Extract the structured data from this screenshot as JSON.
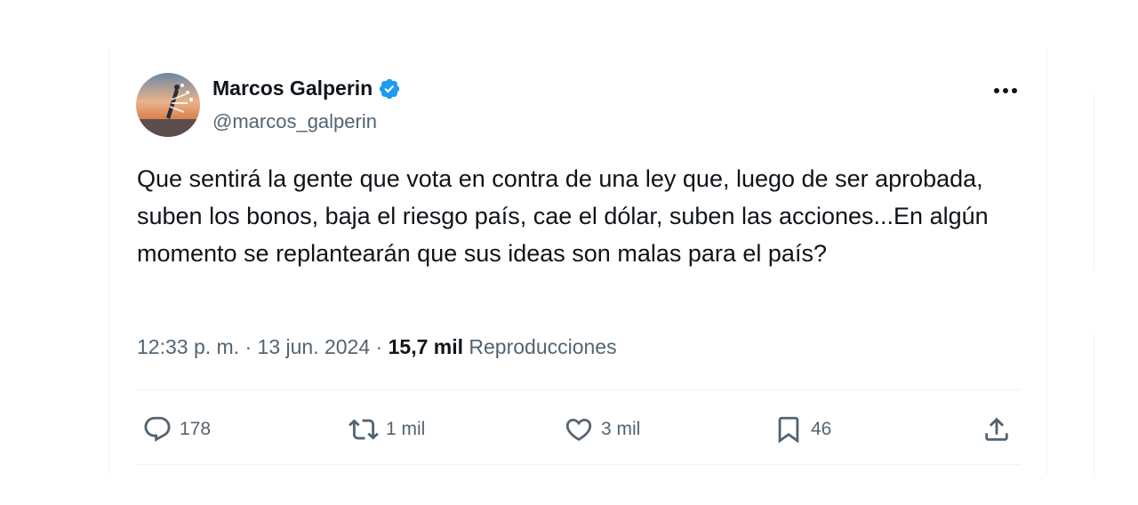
{
  "tweet": {
    "author": {
      "name": "Marcos Galperin",
      "handle": "@marcos_galperin",
      "verified": true
    },
    "text": "Que sentirá la gente que vota en contra de una ley que, luego de ser aprobada, suben los bonos, baja el riesgo país, cae el dólar, suben las acciones...En algún momento se replantearán que sus ideas son malas para el país?",
    "time": "12:33 p. m.",
    "separator": "·",
    "date": "13 jun. 2024",
    "views": "15,7 mil",
    "views_label": "Reproducciones",
    "actions": {
      "replies": "178",
      "retweets": "1 mil",
      "likes": "3 mil",
      "bookmarks": "46"
    }
  },
  "icons": {
    "verified": "verified-badge-icon",
    "more": "more-horizontal-icon",
    "reply": "reply-icon",
    "retweet": "retweet-icon",
    "like": "heart-icon",
    "bookmark": "bookmark-icon",
    "share": "share-icon"
  },
  "colors": {
    "verified": "#1d9bf0",
    "text": "#0f1419",
    "secondary": "#536471",
    "border": "#eff3f4"
  }
}
